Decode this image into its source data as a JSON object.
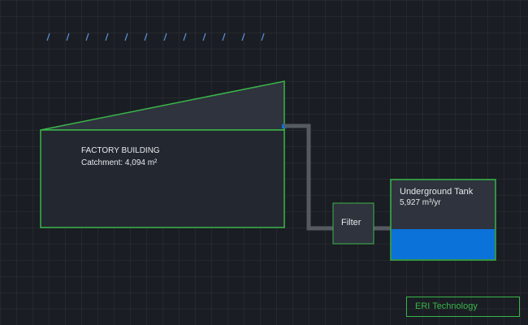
{
  "building": {
    "title": "FACTORY BUILDING",
    "catchment": "Catchment: 4,094 m²"
  },
  "filter": {
    "label": "Filter"
  },
  "tank": {
    "title": "Underground Tank",
    "volume": "5,927 m³/yr",
    "fill_level": 0.38
  },
  "badge": {
    "label": "ERI Technology"
  },
  "colors": {
    "background": "#1a1d23",
    "outline": "#3ab54a",
    "box_fill": "#2e333d",
    "pipe": "#555a61",
    "water": "#0b72d9",
    "rain": "#5b8fd6"
  }
}
